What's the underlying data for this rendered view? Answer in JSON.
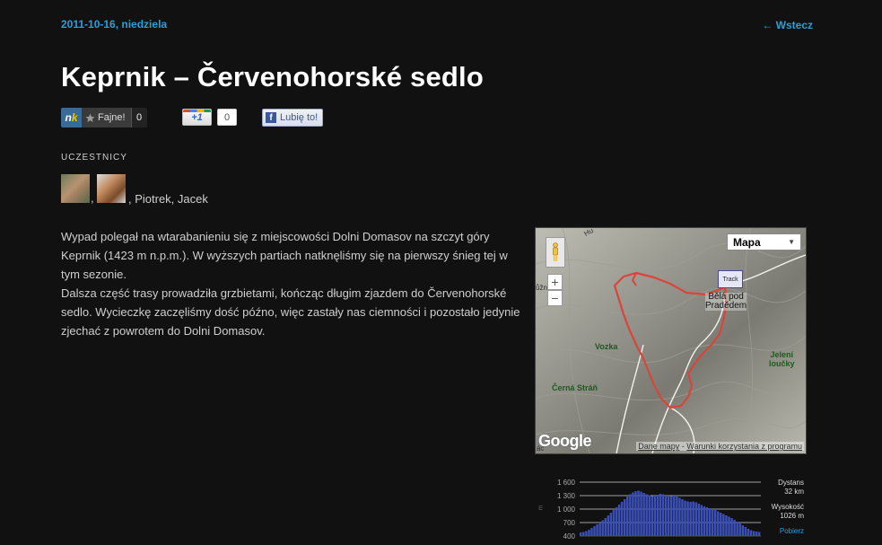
{
  "post": {
    "date": "2011-10-16, niedziela",
    "back_link": "← Wstecz",
    "title": "Keprnik – Červenohorské sedlo"
  },
  "social": {
    "nk": {
      "logo_n": "n",
      "logo_k": "k",
      "label": "Fajne!",
      "count": "0"
    },
    "gplus": {
      "label": "+1",
      "count": "0"
    },
    "facebook": {
      "icon": "f",
      "label": "Lubię to!"
    }
  },
  "participants": {
    "heading": "UCZESTNICY",
    "separator": ",",
    "names": ", Piotrek, Jacek"
  },
  "description": {
    "paragraph1": "Wypad polegał na wtarabanieniu się z miejscowości Dolni Domasov na szczyt góry Keprnik (1423 m n.p.m.). W wyższych partiach natknęliśmy się na pierwszy śnieg tej w tym sezonie.",
    "paragraph2": "Dalsza część trasy prowadziła grzbietami, kończąc długim zjazdem do Červenohorské sedlo. Wycieczkę zaczęliśmy dość późno, więc zastały nas ciemności i pozostało jedynie zjechać z powrotem do Dolni Domasov."
  },
  "map": {
    "type_select": "Mapa",
    "marker_label": "Track",
    "place_labels": {
      "bela": "Bělá pod\nPradědem",
      "vozka": "Vozka",
      "cerna": "Černá Stráň",
      "jeleni": "Jelení\nloučky"
    },
    "edge_texts": [
      "Hu",
      "ůžn",
      "ác"
    ],
    "google_logo": "Google",
    "data_label": "Dane mapy",
    "terms_separator": " - ",
    "terms_label": "Warunki korzystania z programu",
    "zoom_in": "+",
    "zoom_out": "−",
    "route_color": "#d9453a"
  },
  "elevation": {
    "y_ticks": [
      "1 600",
      "1 300",
      "1 000",
      "700",
      "400"
    ],
    "y_unit": "m",
    "distance_label": "Dystans",
    "distance_value": "32 km",
    "altitude_label": "Wysokość",
    "altitude_value": "1026 m",
    "download_link": "Pobierz",
    "bar_color": "#3a4fb8",
    "profile": [
      480,
      490,
      510,
      540,
      580,
      620,
      660,
      700,
      750,
      800,
      860,
      920,
      980,
      1040,
      1100,
      1160,
      1220,
      1280,
      1330,
      1370,
      1400,
      1410,
      1390,
      1360,
      1330,
      1310,
      1290,
      1300,
      1320,
      1340,
      1330,
      1300,
      1280,
      1290,
      1300,
      1280,
      1250,
      1220,
      1190,
      1170,
      1160,
      1170,
      1150,
      1120,
      1090,
      1060,
      1040,
      1020,
      1000,
      980,
      950,
      920,
      890,
      860,
      830,
      800,
      760,
      720,
      680,
      640,
      600,
      560,
      530,
      510,
      500,
      490
    ]
  }
}
